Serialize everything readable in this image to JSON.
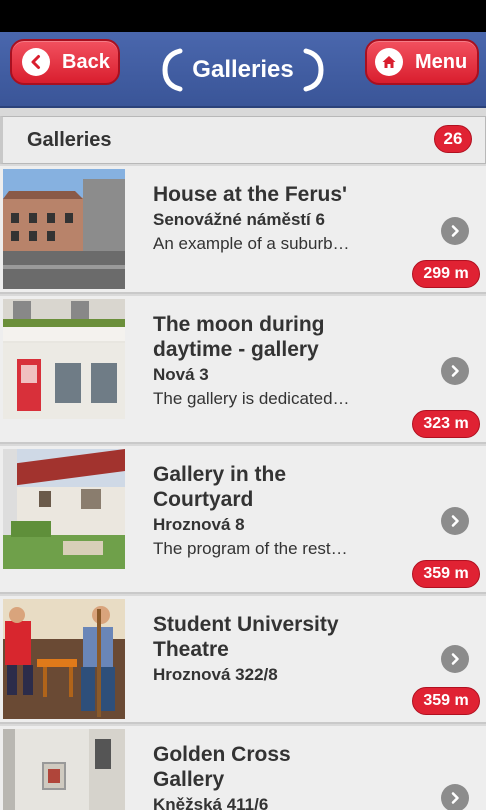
{
  "header": {
    "back_label": "Back",
    "menu_label": "Menu",
    "title": "Galleries"
  },
  "list": {
    "title": "Galleries",
    "count": "26",
    "items": [
      {
        "title_line1": "House at the Ferus'",
        "title_line2": "",
        "address": "Senovážné náměstí 6",
        "description": "An example of a suburb…",
        "distance": "299 m"
      },
      {
        "title_line1": "The moon during",
        "title_line2": "daytime - gallery",
        "address": "Nová 3",
        "description": "The gallery is dedicated…",
        "distance": "323 m"
      },
      {
        "title_line1": "Gallery in the",
        "title_line2": "Courtyard",
        "address": "Hroznová 8",
        "description": "The program of the rest…",
        "distance": "359 m"
      },
      {
        "title_line1": "Student University",
        "title_line2": "Theatre",
        "address": "Hroznová 322/8",
        "description": "",
        "distance": "359 m"
      },
      {
        "title_line1": "Golden Cross",
        "title_line2": "Gallery",
        "address": "Kněžská 411/6",
        "description": "",
        "distance": ""
      }
    ]
  },
  "colors": {
    "header_blue": "#3f5ba0",
    "accent_red": "#e02233",
    "chevron_gray": "#8c8c8c"
  },
  "icons": {
    "back": "arrow-left-icon",
    "menu": "home-icon",
    "row_action": "chevron-right-icon"
  }
}
